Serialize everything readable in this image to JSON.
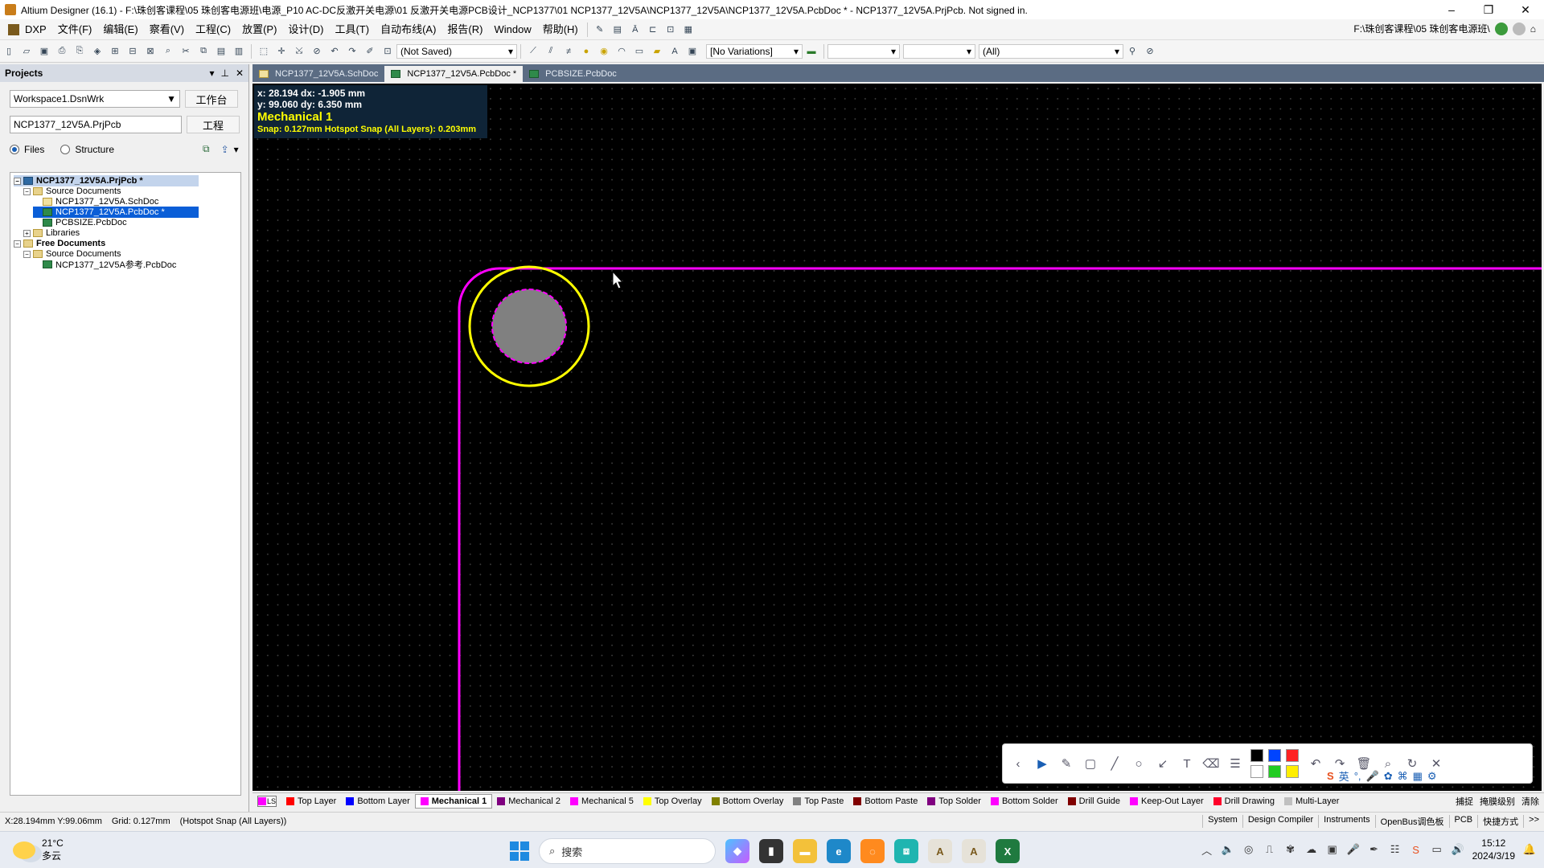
{
  "window": {
    "title": "Altium Designer (16.1) - F:\\珠创客课程\\05 珠创客电源班\\电源_P10 AC-DC反激开关电源\\01 反激开关电源PCB设计_NCP1377\\01 NCP1377_12V5A\\NCP1377_12V5A\\NCP1377_12V5A.PcbDoc * - NCP1377_12V5A.PrjPcb. Not signed in.",
    "min": "–",
    "max": "❐",
    "close": "✕"
  },
  "menu": [
    "DXP",
    "文件(F)",
    "编辑(E)",
    "察看(V)",
    "工程(C)",
    "放置(P)",
    "设计(D)",
    "工具(T)",
    "自动布线(A)",
    "报告(R)",
    "Window",
    "帮助(H)"
  ],
  "right_path": "F:\\珠创客课程\\05 珠创客电源班\\",
  "toolbar": {
    "saved_state": "(Not Saved)",
    "variations": "[No Variations]",
    "filter": "(All)"
  },
  "panel": {
    "title": "Projects",
    "workspace": "Workspace1.DsnWrk",
    "workspace_btn": "工作台",
    "project": "NCP1377_12V5A.PrjPcb",
    "project_btn": "工程",
    "radio_files": "Files",
    "radio_structure": "Structure",
    "tree": [
      {
        "label": "NCP1377_12V5A.PrjPcb *",
        "level": 0,
        "exp": "−",
        "icon": "proj",
        "style": "root"
      },
      {
        "label": "Source Documents",
        "level": 1,
        "exp": "−",
        "icon": "folder",
        "style": ""
      },
      {
        "label": "NCP1377_12V5A.SchDoc",
        "level": 2,
        "exp": "",
        "icon": "sch",
        "style": ""
      },
      {
        "label": "NCP1377_12V5A.PcbDoc *",
        "level": 2,
        "exp": "",
        "icon": "pcb",
        "style": "sel"
      },
      {
        "label": "PCBSIZE.PcbDoc",
        "level": 2,
        "exp": "",
        "icon": "pcb",
        "style": ""
      },
      {
        "label": "Libraries",
        "level": 1,
        "exp": "+",
        "icon": "folder",
        "style": ""
      },
      {
        "label": "Free Documents",
        "level": 0,
        "exp": "−",
        "icon": "folder",
        "style": "bold"
      },
      {
        "label": "Source Documents",
        "level": 1,
        "exp": "−",
        "icon": "folder",
        "style": ""
      },
      {
        "label": "NCP1377_12V5A参考.PcbDoc",
        "level": 2,
        "exp": "",
        "icon": "pcb",
        "style": ""
      }
    ]
  },
  "doc_tabs": [
    {
      "label": "NCP1377_12V5A.SchDoc",
      "active": false,
      "icon": "sch"
    },
    {
      "label": "NCP1377_12V5A.PcbDoc *",
      "active": true,
      "icon": "pcb"
    },
    {
      "label": "PCBSIZE.PcbDoc",
      "active": false,
      "icon": "pcb"
    }
  ],
  "hud": {
    "line1": "x: 28.194   dx: -1.905 mm",
    "line2": "y: 99.060   dy: 6.350 mm",
    "layer": "Mechanical 1",
    "snap": "Snap: 0.127mm Hotspot Snap (All Layers): 0.203mm"
  },
  "layers": [
    {
      "name": "Top Layer",
      "color": "#ff0000",
      "active": false
    },
    {
      "name": "Bottom Layer",
      "color": "#0000ff",
      "active": false
    },
    {
      "name": "Mechanical 1",
      "color": "#ff00ff",
      "active": true
    },
    {
      "name": "Mechanical 2",
      "color": "#800080",
      "active": false
    },
    {
      "name": "Mechanical 5",
      "color": "#ff00ff",
      "active": false
    },
    {
      "name": "Top Overlay",
      "color": "#ffff00",
      "active": false
    },
    {
      "name": "Bottom Overlay",
      "color": "#808000",
      "active": false
    },
    {
      "name": "Top Paste",
      "color": "#808080",
      "active": false
    },
    {
      "name": "Bottom Paste",
      "color": "#800000",
      "active": false
    },
    {
      "name": "Top Solder",
      "color": "#800080",
      "active": false
    },
    {
      "name": "Bottom Solder",
      "color": "#ff00ff",
      "active": false
    },
    {
      "name": "Drill Guide",
      "color": "#800000",
      "active": false
    },
    {
      "name": "Keep-Out Layer",
      "color": "#ff00ff",
      "active": false
    },
    {
      "name": "Drill Drawing",
      "color": "#ff002a",
      "active": false
    },
    {
      "name": "Multi-Layer",
      "color": "#c0c0c0",
      "active": false
    }
  ],
  "layer_ls": "LS",
  "layer_right": [
    "捕捉",
    "掩膜级别",
    "清除"
  ],
  "status": {
    "coords": "X:28.194mm Y:99.06mm",
    "grid": "Grid: 0.127mm",
    "snap": "(Hotspot Snap (All Layers))",
    "right": [
      "System",
      "Design Compiler",
      "Instruments",
      "OpenBus调色板",
      "PCB",
      "快捷方式",
      ">>"
    ]
  },
  "taskbar": {
    "temp": "21°C",
    "weather": "多云",
    "search": "搜索",
    "time": "15:12",
    "date": "2024/3/19"
  },
  "drawing_colors": [
    "#000000",
    "#0044ff",
    "#ff2222",
    "#ffffff",
    "#22cc22",
    "#ffee00"
  ],
  "ime": "英"
}
